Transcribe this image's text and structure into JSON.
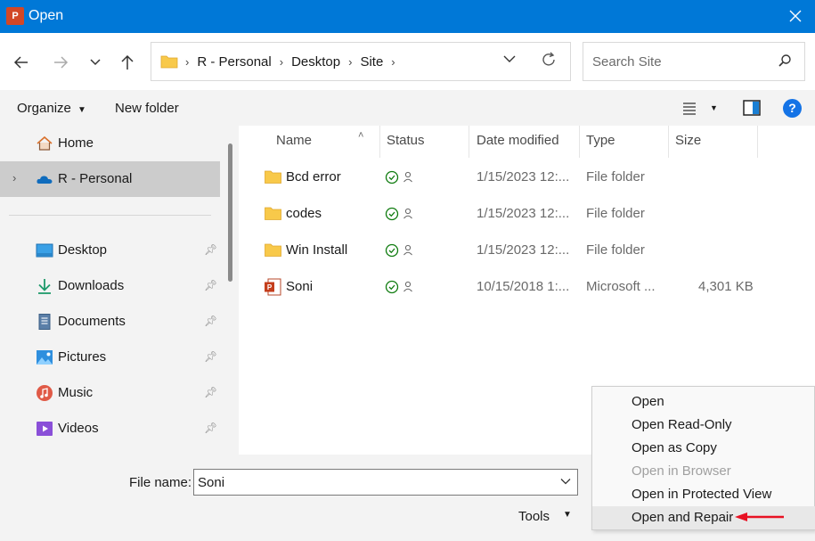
{
  "window": {
    "title": "Open",
    "app_icon_letter": "P"
  },
  "nav": {
    "breadcrumbs": [
      "R - Personal",
      "Desktop",
      "Site"
    ],
    "search_placeholder": "Search Site"
  },
  "commands": {
    "organize": "Organize",
    "new_folder": "New folder",
    "help": "?"
  },
  "sidebar": {
    "items": [
      {
        "label": "Home",
        "icon": "home-icon"
      },
      {
        "label": "R - Personal",
        "icon": "cloud-icon"
      },
      {
        "label": "Desktop",
        "icon": "desktop-icon"
      },
      {
        "label": "Downloads",
        "icon": "download-icon"
      },
      {
        "label": "Documents",
        "icon": "document-icon"
      },
      {
        "label": "Pictures",
        "icon": "picture-icon"
      },
      {
        "label": "Music",
        "icon": "music-icon"
      },
      {
        "label": "Videos",
        "icon": "video-icon"
      }
    ]
  },
  "columns": {
    "name": "Name",
    "status": "Status",
    "date_modified": "Date modified",
    "type": "Type",
    "size": "Size"
  },
  "files": [
    {
      "name": "Bcd error",
      "date": "1/15/2023 12:...",
      "type": "File folder",
      "size": "",
      "icon": "folder-icon"
    },
    {
      "name": "codes",
      "date": "1/15/2023 12:...",
      "type": "File folder",
      "size": "",
      "icon": "folder-icon"
    },
    {
      "name": "Win Install",
      "date": "1/15/2023 12:...",
      "type": "File folder",
      "size": "",
      "icon": "folder-icon"
    },
    {
      "name": "Soni",
      "date": "10/15/2018 1:...",
      "type": "Microsoft ...",
      "size": "4,301 KB",
      "icon": "powerpoint-file-icon"
    }
  ],
  "bottom": {
    "file_name_label": "File name:",
    "file_name_value": "Soni",
    "tools_label": "Tools"
  },
  "open_menu": {
    "items": [
      {
        "label": "Open",
        "disabled": false
      },
      {
        "label": "Open Read-Only",
        "disabled": false
      },
      {
        "label": "Open as Copy",
        "disabled": false
      },
      {
        "label": "Open in Browser",
        "disabled": true
      },
      {
        "label": "Open in Protected View",
        "disabled": false
      },
      {
        "label": "Open and Repair",
        "disabled": false
      }
    ]
  },
  "colors": {
    "titlebar": "#0078d7",
    "accent_arrow": "#e81123",
    "status_green": "#107c10"
  }
}
